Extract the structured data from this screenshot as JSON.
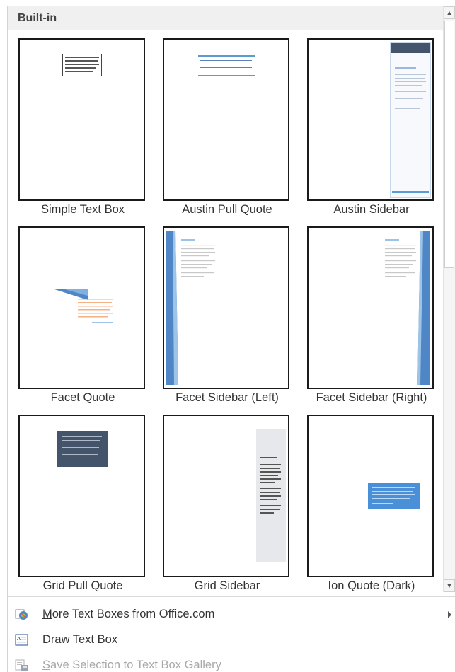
{
  "gallery": {
    "section_title": "Built-in",
    "items": [
      {
        "label": "Simple Text Box"
      },
      {
        "label": "Austin Pull Quote"
      },
      {
        "label": "Austin Sidebar"
      },
      {
        "label": "Facet Quote"
      },
      {
        "label": "Facet Sidebar (Left)"
      },
      {
        "label": "Facet Sidebar (Right)"
      },
      {
        "label": "Grid Pull Quote"
      },
      {
        "label": "Grid Sidebar"
      },
      {
        "label": "Ion Quote (Dark)"
      }
    ]
  },
  "menu": {
    "more_prefix": "M",
    "more_rest": "ore Text Boxes from Office.com",
    "draw_prefix": "D",
    "draw_rest": "raw Text Box",
    "save_prefix": "S",
    "save_rest": "ave Selection to Text Box Gallery"
  },
  "colors": {
    "austin_blue": "#5b9bd5",
    "facet_blue": "#4f86c6",
    "facet_orange": "#ed7d31",
    "grid_dark": "#44546a",
    "ion_blue": "#4a90d9",
    "grid_sidebar_gray": "#e7e8ec"
  }
}
